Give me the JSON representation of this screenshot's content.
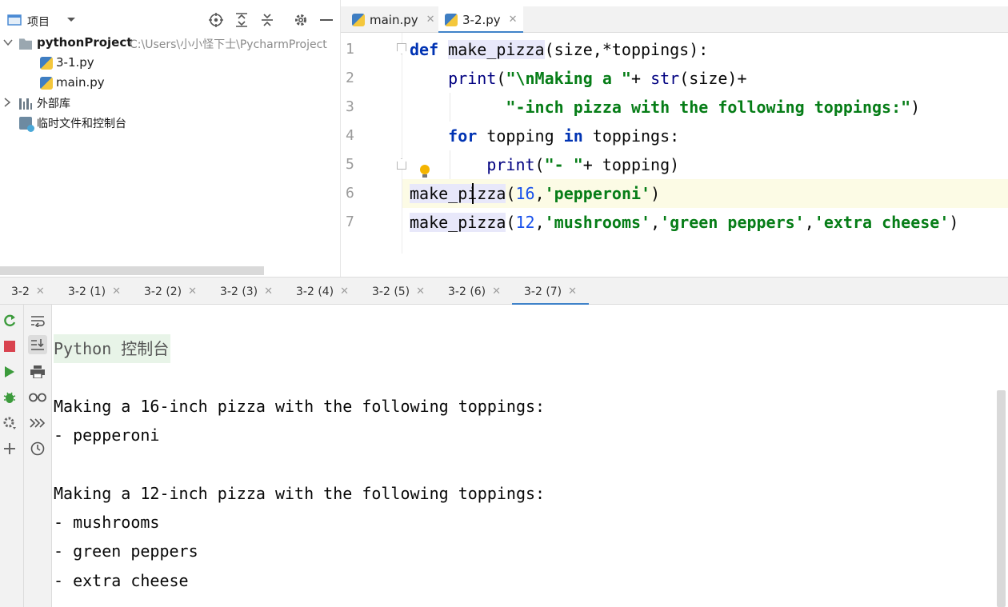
{
  "project_panel": {
    "title": "项目",
    "tree": [
      {
        "label": "pythonProject",
        "path": "C:\\Users\\小小怪下士\\PycharmProject"
      },
      {
        "label": "3-1.py"
      },
      {
        "label": "main.py"
      },
      {
        "label": "外部库"
      },
      {
        "label": "临时文件和控制台"
      }
    ]
  },
  "editor": {
    "tabs": [
      {
        "label": "main.py"
      },
      {
        "label": "3-2.py"
      }
    ],
    "line_numbers": [
      "1",
      "2",
      "3",
      "4",
      "5",
      "6",
      "7"
    ],
    "code": {
      "l1_kw": "def",
      "l1_fn": "make_pizza",
      "l1_rest": "(size,*toppings):",
      "l2_fn": "print",
      "l2_open": "(",
      "l2_str": "\"\\nMaking a \"",
      "l2_plus": "+ ",
      "l2_builtin": "str",
      "l2_rest": "(size)+",
      "l3_str": "\"-inch pizza with the following toppings:\"",
      "l3_rest": ")",
      "l4_kw1": "for",
      "l4_mid": " topping ",
      "l4_kw2": "in",
      "l4_rest": " toppings:",
      "l5_fn": "print",
      "l5_open": "(",
      "l5_str": "\"- \"",
      "l5_rest": "+ topping)",
      "l6_fn": "make_pizza",
      "l6_open": "(",
      "l6_num": "16",
      "l6_comma": ",",
      "l6_str": "'pepperoni'",
      "l6_close": ")",
      "l7_fn": "make_pizza",
      "l7_open": "(",
      "l7_num": "12",
      "l7_c1": ",",
      "l7_s1": "'mushrooms'",
      "l7_c2": ",",
      "l7_s2": "'green peppers'",
      "l7_c3": ",",
      "l7_s3": "'extra cheese'",
      "l7_close": ")"
    }
  },
  "run_tabs": [
    "3-2",
    "3-2 (1)",
    "3-2 (2)",
    "3-2 (3)",
    "3-2 (4)",
    "3-2 (5)",
    "3-2 (6)",
    "3-2 (7)"
  ],
  "console": {
    "header": "Python 控制台",
    "lines": [
      "Making a 16-inch pizza with the following toppings:",
      "- pepperoni",
      "",
      "Making a 12-inch pizza with the following toppings:",
      "- mushrooms",
      "- green peppers",
      "- extra cheese"
    ]
  },
  "icons": {
    "project_view": "panel-icon",
    "dropdown": "chevron-down-icon",
    "locate": "crosshair-icon",
    "expand": "expand-all-icon",
    "collapse": "collapse-all-icon",
    "settings": "gear-icon",
    "hide": "minimize-icon"
  },
  "colors": {
    "accent": "#4083c9",
    "keyword": "#0033b3",
    "string": "#067d17",
    "number": "#1750eb",
    "run_green": "#3c9b3c",
    "stop_red": "#d9434f"
  }
}
